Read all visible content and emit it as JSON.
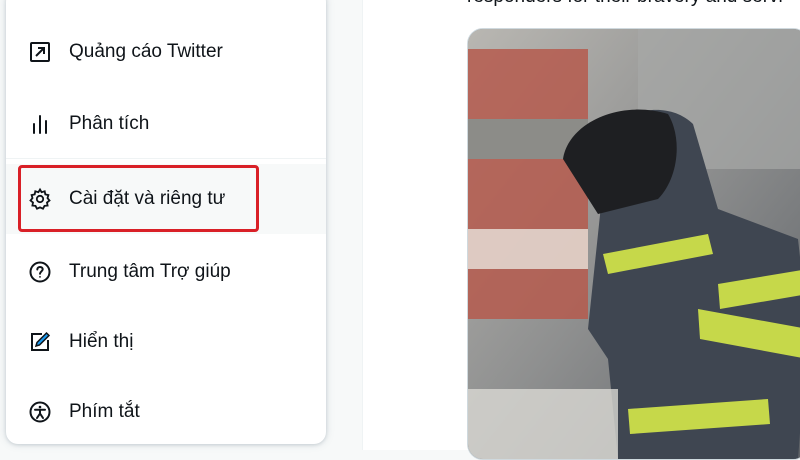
{
  "menu": {
    "items": [
      {
        "label": "Quảng cáo Twitter",
        "icon": "external-link-icon"
      },
      {
        "label": "Phân tích",
        "icon": "analytics-icon"
      },
      {
        "label": "Cài đặt và riêng tư",
        "icon": "gear-icon"
      },
      {
        "label": "Trung tâm Trợ giúp",
        "icon": "help-icon"
      },
      {
        "label": "Hiển thị",
        "icon": "display-edit-icon"
      },
      {
        "label": "Phím tắt",
        "icon": "accessibility-icon"
      }
    ]
  },
  "tweet": {
    "text": "responders for their bravery and servi",
    "photo_alt": "firefighter-photo"
  },
  "colors": {
    "highlight": "#d92027",
    "text": "#0f1419",
    "hover_bg": "#f7f9f9"
  }
}
